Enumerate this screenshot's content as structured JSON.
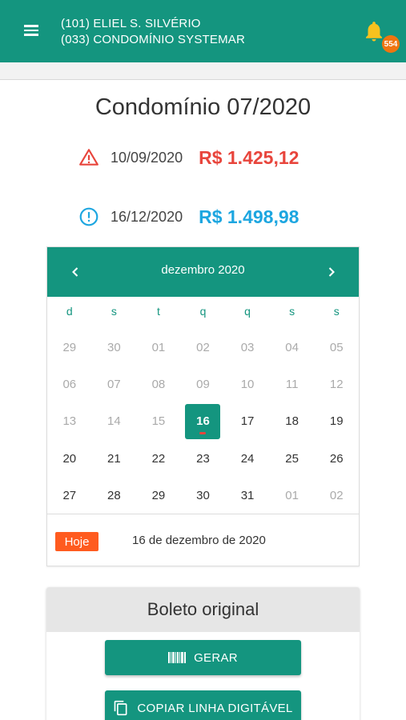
{
  "header": {
    "user_line": "(101) ELIEL S. SILVÉRIO",
    "condo_line": "(033) CONDOMÍNIO SYSTEMAR",
    "notification_count": "554"
  },
  "title": "Condomínio 07/2020",
  "original_due": {
    "date": "10/09/2020",
    "amount": "R$ 1.425,12",
    "icon": "warning-icon",
    "color": "#e8453c"
  },
  "updated_due": {
    "date": "16/12/2020",
    "amount": "R$ 1.498,98",
    "icon": "info-icon",
    "color": "#1da6e0"
  },
  "calendar": {
    "month_label": "dezembro 2020",
    "prev": "‹",
    "next": "›",
    "weekdays": [
      "d",
      "s",
      "t",
      "q",
      "q",
      "s",
      "s"
    ],
    "days": [
      {
        "n": "29",
        "muted": true
      },
      {
        "n": "30",
        "muted": true
      },
      {
        "n": "01",
        "muted": true
      },
      {
        "n": "02",
        "muted": true
      },
      {
        "n": "03",
        "muted": true
      },
      {
        "n": "04",
        "muted": true
      },
      {
        "n": "05",
        "muted": true
      },
      {
        "n": "06",
        "muted": true
      },
      {
        "n": "07",
        "muted": true
      },
      {
        "n": "08",
        "muted": true
      },
      {
        "n": "09",
        "muted": true
      },
      {
        "n": "10",
        "muted": true
      },
      {
        "n": "11",
        "muted": true
      },
      {
        "n": "12",
        "muted": true
      },
      {
        "n": "13",
        "muted": true
      },
      {
        "n": "14",
        "muted": true
      },
      {
        "n": "15",
        "muted": true
      },
      {
        "n": "16",
        "selected": true
      },
      {
        "n": "17"
      },
      {
        "n": "18"
      },
      {
        "n": "19"
      },
      {
        "n": "20"
      },
      {
        "n": "21"
      },
      {
        "n": "22"
      },
      {
        "n": "23"
      },
      {
        "n": "24"
      },
      {
        "n": "25"
      },
      {
        "n": "26"
      },
      {
        "n": "27"
      },
      {
        "n": "28"
      },
      {
        "n": "29"
      },
      {
        "n": "30"
      },
      {
        "n": "31"
      },
      {
        "n": "01",
        "muted": true
      },
      {
        "n": "02",
        "muted": true
      }
    ],
    "today_label": "Hoje",
    "today_text": "16 de dezembro de 2020"
  },
  "boleto": {
    "title": "Boleto original",
    "generate_label": "GERAR",
    "copy_label": "COPIAR LINHA DIGITÁVEL"
  },
  "colors": {
    "primary": "#14957f",
    "accent": "#ff5b1f",
    "badge": "#f0750f"
  }
}
